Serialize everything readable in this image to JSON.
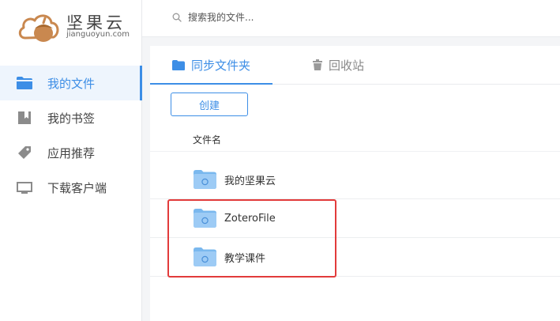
{
  "brand": {
    "name": "坚果云",
    "domain": "jianguoyun.com",
    "accent": "#3d8ee6",
    "mark_color": "#c9884f"
  },
  "search": {
    "placeholder": "搜索我的文件...",
    "icon": "search-icon"
  },
  "sidebar": {
    "items": [
      {
        "label": "我的文件",
        "icon": "folder-icon",
        "active": true
      },
      {
        "label": "我的书签",
        "icon": "bookmark-icon",
        "active": false
      },
      {
        "label": "应用推荐",
        "icon": "tag-icon",
        "active": false
      },
      {
        "label": "下载客户端",
        "icon": "monitor-icon",
        "active": false
      }
    ]
  },
  "main": {
    "tabs": [
      {
        "label": "同步文件夹",
        "icon": "folder-icon",
        "active": true
      },
      {
        "label": "回收站",
        "icon": "trash-icon",
        "active": false
      }
    ],
    "create_label": "创建",
    "column_name": "文件名",
    "files": [
      {
        "name": "我的坚果云",
        "icon": "sync-folder-icon",
        "highlighted": false
      },
      {
        "name": "ZoteroFile",
        "icon": "sync-folder-icon",
        "highlighted": true
      },
      {
        "name": "教学课件",
        "icon": "sync-folder-icon",
        "highlighted": true
      }
    ]
  },
  "highlight_color": "#e23b3b"
}
